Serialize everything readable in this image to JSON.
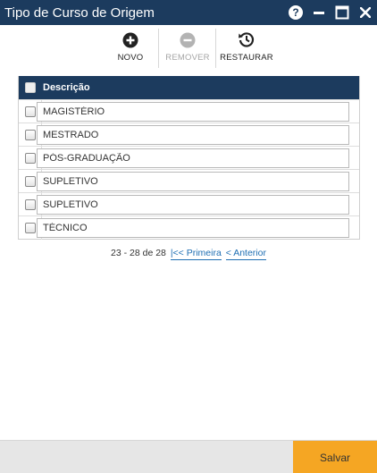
{
  "window": {
    "title": "Tipo de Curso de Origem"
  },
  "toolbar": {
    "new_label": "NOVO",
    "remove_label": "REMOVER",
    "restore_label": "RESTAURAR"
  },
  "grid": {
    "header_label": "Descrição",
    "rows": [
      {
        "descricao": "MAGISTÉRIO"
      },
      {
        "descricao": "MESTRADO"
      },
      {
        "descricao": "PÓS-GRADUAÇÃO"
      },
      {
        "descricao": "SUPLETIVO"
      },
      {
        "descricao": "SUPLETIVO"
      },
      {
        "descricao": "TÉCNICO"
      }
    ]
  },
  "pager": {
    "range": "23 - 28 de 28",
    "first_label": "|<< Primeira",
    "prev_label": "< Anterior"
  },
  "footer": {
    "save_label": "Salvar"
  },
  "colors": {
    "titlebar": "#1c3b5e",
    "accent": "#f5a623",
    "link": "#1f6fb3"
  }
}
